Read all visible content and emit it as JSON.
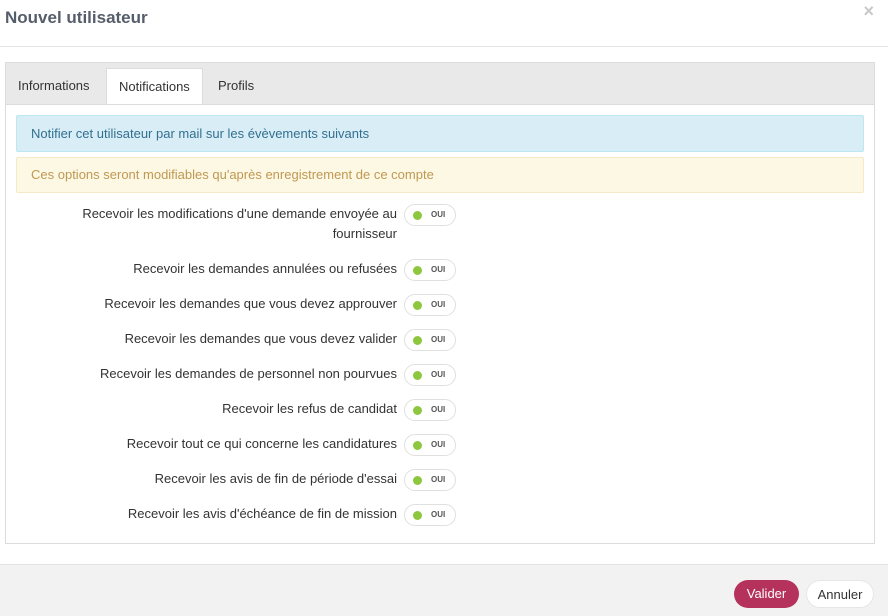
{
  "header": {
    "title": "Nouvel utilisateur",
    "close_glyph": "×"
  },
  "tabs": [
    {
      "label": "Informations",
      "active": false
    },
    {
      "label": "Notifications",
      "active": true
    },
    {
      "label": "Profils",
      "active": false
    }
  ],
  "alerts": {
    "info": "Notifier cet utilisateur par mail sur les évèvements suivants",
    "warning": "Ces options seront modifiables qu'après enregistrement de ce compte"
  },
  "notifications": [
    {
      "label_line1": "Recevoir les modifications d'une demande envoyée au",
      "label_line2": "fournisseur",
      "state": "OUI"
    },
    {
      "label_line1": "Recevoir les demandes annulées ou refusées",
      "state": "OUI"
    },
    {
      "label_line1": "Recevoir les demandes que vous devez approuver",
      "state": "OUI"
    },
    {
      "label_line1": "Recevoir les demandes que vous devez valider",
      "state": "OUI"
    },
    {
      "label_line1": "Recevoir les demandes de personnel non pourvues",
      "state": "OUI"
    },
    {
      "label_line1": "Recevoir les refus de candidat",
      "state": "OUI"
    },
    {
      "label_line1": "Recevoir tout ce qui concerne les candidatures",
      "state": "OUI"
    },
    {
      "label_line1": "Recevoir les avis de fin de période d'essai",
      "state": "OUI"
    },
    {
      "label_line1": "Recevoir les avis d'échéance de fin de mission",
      "state": "OUI"
    }
  ],
  "footer": {
    "primary_label": "Valider",
    "cancel_label": "Annuler"
  },
  "colors": {
    "toggle_on": "#8dc63f",
    "primary_button": "#b5325c"
  }
}
